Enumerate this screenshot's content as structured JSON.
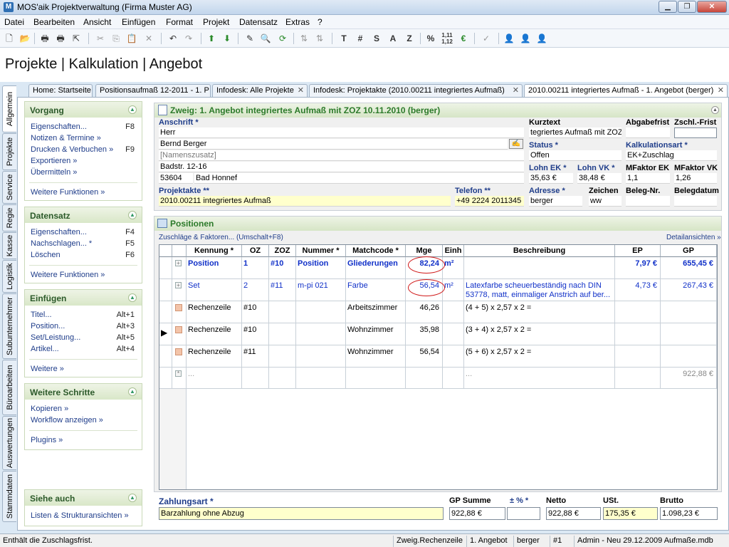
{
  "window": {
    "title": "MOS'aik Projektverwaltung (Firma Muster AG)"
  },
  "menu": [
    "Datei",
    "Bearbeiten",
    "Ansicht",
    "Einfügen",
    "Format",
    "Projekt",
    "Datensatz",
    "Extras",
    "?"
  ],
  "toolbar_text_buttons": [
    "T",
    "#",
    "S",
    "A",
    "Z",
    "%"
  ],
  "page_heading": "Projekte | Kalkulation | Angebot",
  "vertical_tabs": [
    "Allgemein",
    "Projekte",
    "Service",
    "Regie",
    "Kasse",
    "Logistik",
    "Subunternehmer",
    "Büroarbeiten",
    "Auswertungen",
    "Stammdaten"
  ],
  "doc_tabs": [
    {
      "label": "Home: Startseite"
    },
    {
      "label": "Positionsaufmaß 12-2011 - 1. P"
    },
    {
      "label": "Infodesk: Alle Projekte"
    },
    {
      "label": "Infodesk: Projektakte (2010.00211 integriertes Aufmaß)"
    },
    {
      "label": "2010.00211 integriertes Aufmaß - 1. Angebot (berger)"
    }
  ],
  "sidebar": {
    "vorgang": {
      "title": "Vorgang",
      "items": [
        {
          "label": "Eigenschaften...",
          "key": "F8"
        },
        {
          "label": "Notizen & Termine »",
          "key": ""
        },
        {
          "label": "Drucken & Verbuchen »",
          "key": "F9"
        },
        {
          "label": "Exportieren »",
          "key": ""
        },
        {
          "label": "Übermitteln »",
          "key": ""
        }
      ],
      "more": "Weitere Funktionen »"
    },
    "datensatz": {
      "title": "Datensatz",
      "items": [
        {
          "label": "Eigenschaften...",
          "key": "F4"
        },
        {
          "label": "Nachschlagen... *",
          "key": "F5"
        },
        {
          "label": "Löschen",
          "key": "F6"
        }
      ],
      "more": "Weitere Funktionen »"
    },
    "einfuegen": {
      "title": "Einfügen",
      "items": [
        {
          "label": "Titel...",
          "key": "Alt+1"
        },
        {
          "label": "Position...",
          "key": "Alt+3"
        },
        {
          "label": "Set/Leistung...",
          "key": "Alt+5"
        },
        {
          "label": "Artikel...",
          "key": "Alt+4"
        }
      ],
      "more": "Weitere »"
    },
    "weitere": {
      "title": "Weitere Schritte",
      "items": [
        {
          "label": "Kopieren »"
        },
        {
          "label": "Workflow anzeigen »"
        }
      ],
      "more": "Plugins »"
    },
    "siehe": {
      "title": "Siehe auch",
      "items": [
        {
          "label": "Listen & Strukturansichten »"
        }
      ]
    }
  },
  "zweig": {
    "title": "Zweig: 1. Angebot  integriertes Aufmaß mit ZOZ 10.11.2010 (berger)",
    "anschrift_label": "Anschrift *",
    "anschrift": [
      "Herr",
      "Bernd Berger",
      "[Namenszusatz]",
      "Badstr. 12-16"
    ],
    "plz": "53604",
    "ort": "Bad Honnef",
    "projektakte_label": "Projektakte **",
    "projektakte": "2010.00211 integriertes Aufmaß",
    "telefon_label": "Telefon **",
    "telefon": "+49 2224 2011345",
    "kurztext_label": "Kurztext",
    "kurztext": "tegriertes Aufmaß mit ZOZ",
    "abgabefrist_label": "Abgabefrist",
    "abgabefrist": "",
    "zschl_frist_label": "Zschl.-Frist",
    "zschl_frist": "",
    "status_label": "Status *",
    "status": "Offen",
    "kalkulationsart_label": "Kalkulationsart *",
    "kalkulationsart": "EK+Zuschlag",
    "lohn_ek_label": "Lohn EK *",
    "lohn_ek": "35,63 €",
    "lohn_vk_label": "Lohn VK *",
    "lohn_vk": "38,48 €",
    "mfaktor_ek_label": "MFaktor EK",
    "mfaktor_ek": "1,1",
    "mfaktor_vk_label": "MFaktor VK",
    "mfaktor_vk": "1,26",
    "adresse_label": "Adresse *",
    "adresse": "berger",
    "zeichen_label": "Zeichen",
    "zeichen": "ww",
    "beleg_nr_label": "Beleg-Nr.",
    "beleg_nr": "",
    "belegdatum_label": "Belegdatum",
    "belegdatum": ""
  },
  "positions": {
    "title": "Positionen",
    "zuschlaege_link": "Zuschläge & Faktoren... (Umschalt+F8)",
    "details_link": "Detailansichten »",
    "columns": [
      "Kennung *",
      "OZ",
      "ZOZ",
      "Nummer *",
      "Matchcode *",
      "Mge",
      "Einh",
      "Beschreibung",
      "EP",
      "GP"
    ],
    "rows": [
      {
        "kennung": "Position",
        "oz": "1",
        "zoz": "#10",
        "nummer": "Position",
        "matchcode": "Gliederungen",
        "mge": "82,24",
        "einh": "m²",
        "beschreibung": "",
        "ep": "7,97 €",
        "gp": "655,45 €"
      },
      {
        "kennung": "Set",
        "oz": "2",
        "zoz": "#11",
        "nummer": "m-pi 021",
        "matchcode": "Farbe",
        "mge": "56,54",
        "einh": "m²",
        "beschreibung": "Latexfarbe scheuerbeständig nach DIN 53778, matt, einmaliger Anstrich auf ber...",
        "ep": "4,73 €",
        "gp": "267,43 €"
      },
      {
        "kennung": "Rechenzeile",
        "oz": "#10",
        "zoz": "",
        "nummer": "",
        "matchcode": "Arbeitszimmer",
        "mge": "46,26",
        "einh": "",
        "beschreibung": "(4 + 5) x 2,57 x 2 =",
        "ep": "",
        "gp": ""
      },
      {
        "kennung": "Rechenzeile",
        "oz": "#10",
        "zoz": "",
        "nummer": "",
        "matchcode": "Wohnzimmer",
        "mge": "35,98",
        "einh": "",
        "beschreibung": "(3 + 4) x 2,57 x 2 =",
        "ep": "",
        "gp": ""
      },
      {
        "kennung": "Rechenzeile",
        "oz": "#11",
        "zoz": "",
        "nummer": "",
        "matchcode": "Wohnzimmer",
        "mge": "56,54",
        "einh": "",
        "beschreibung": "(5 + 6) x 2,57 x 2 =",
        "ep": "",
        "gp": ""
      },
      {
        "kennung": "...",
        "oz": "",
        "zoz": "",
        "nummer": "",
        "matchcode": "",
        "mge": "",
        "einh": "",
        "beschreibung": "...",
        "ep": "",
        "gp": "922,88 €"
      }
    ]
  },
  "footer": {
    "zahlungsart_label": "Zahlungsart *",
    "zahlungsart": "Barzahlung ohne Abzug",
    "gp_summe_label": "GP Summe",
    "gp_summe": "922,88 €",
    "pm_pct_label": "± % *",
    "pm_pct": "",
    "netto_label": "Netto",
    "netto": "922,88 €",
    "ust_label": "USt.",
    "ust": "175,35 €",
    "brutto_label": "Brutto",
    "brutto": "1.098,23 €"
  },
  "statusbar": {
    "message": "Enthält die Zuschlagsfrist.",
    "cells": [
      "Zweig.Rechenzeile",
      "1. Angebot",
      "berger",
      "#1",
      "Admin - Neu 29.12.2009 Aufmaße.mdb"
    ]
  }
}
